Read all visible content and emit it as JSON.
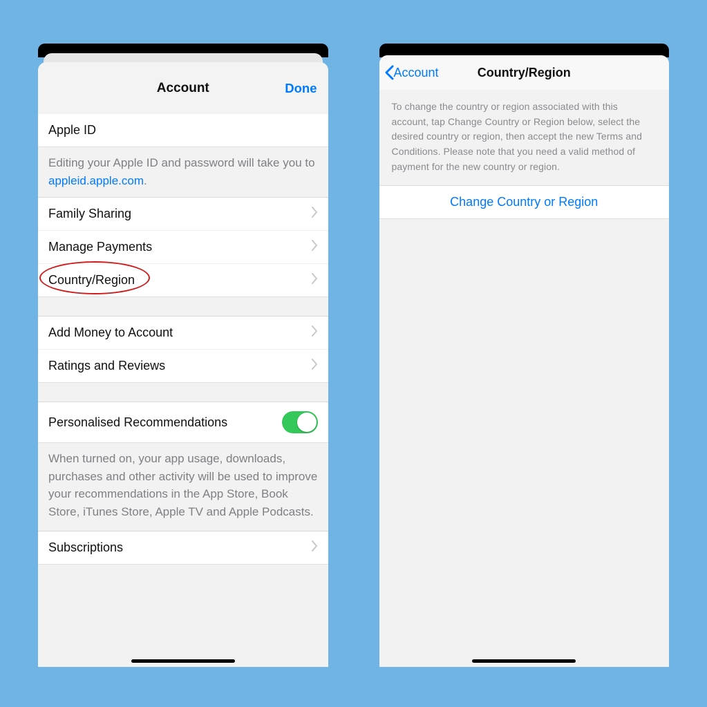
{
  "screen1": {
    "title": "Account",
    "done": "Done",
    "apple_id": {
      "label": "Apple ID"
    },
    "apple_id_footer_prefix": "Editing your Apple ID and password will take you to ",
    "apple_id_footer_link": "appleid.apple.com",
    "apple_id_footer_suffix": ".",
    "rows": {
      "family_sharing": "Family Sharing",
      "manage_payments": "Manage Payments",
      "country_region": "Country/Region",
      "add_money": "Add Money to Account",
      "ratings_reviews": "Ratings and Reviews",
      "subscriptions": "Subscriptions"
    },
    "personalised": {
      "label": "Personalised Recommendations",
      "description": "When turned on, your app usage, downloads, purchases and other activity will be used to improve your recommendations in the App Store, Book Store, iTunes Store, Apple TV and Apple Podcasts."
    }
  },
  "screen2": {
    "back": "Account",
    "title": "Country/Region",
    "info": "To change the country or region associated with this account, tap Change Country or Region below, select the desired country or region, then accept the new Terms and Conditions. Please note that you need a valid method of payment for the new country or region.",
    "action": "Change Country or Region"
  }
}
